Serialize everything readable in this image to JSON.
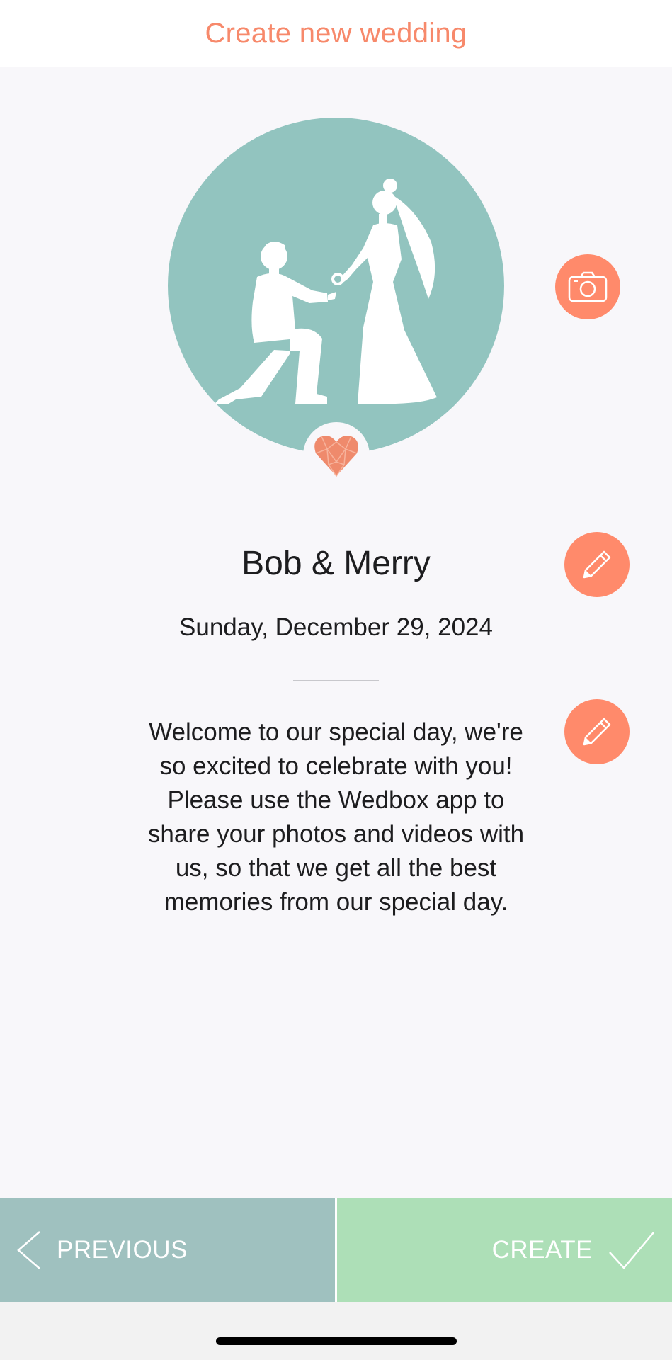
{
  "header": {
    "title": "Create new wedding"
  },
  "hero": {
    "image": "couple-proposal-silhouette",
    "badge_icon": "heart-icon"
  },
  "icons": {
    "camera": "camera-icon",
    "edit": "pencil-icon"
  },
  "wedding": {
    "names": "Bob & Merry",
    "date": "Sunday, December 29, 2024",
    "welcome_message": "Welcome to our special day, we're so excited to celebrate with you! Please use the Wedbox app to share your photos and videos with us, so that we get all the best memories from our special day."
  },
  "footer": {
    "previous_label": "PREVIOUS",
    "create_label": "CREATE"
  },
  "colors": {
    "accent": "#ff8a6b",
    "title": "#f7896b",
    "hero_bg": "#92c4bf",
    "previous_bg": "#9fc1bf",
    "create_bg": "#addfb7",
    "background": "#f8f7fa"
  }
}
